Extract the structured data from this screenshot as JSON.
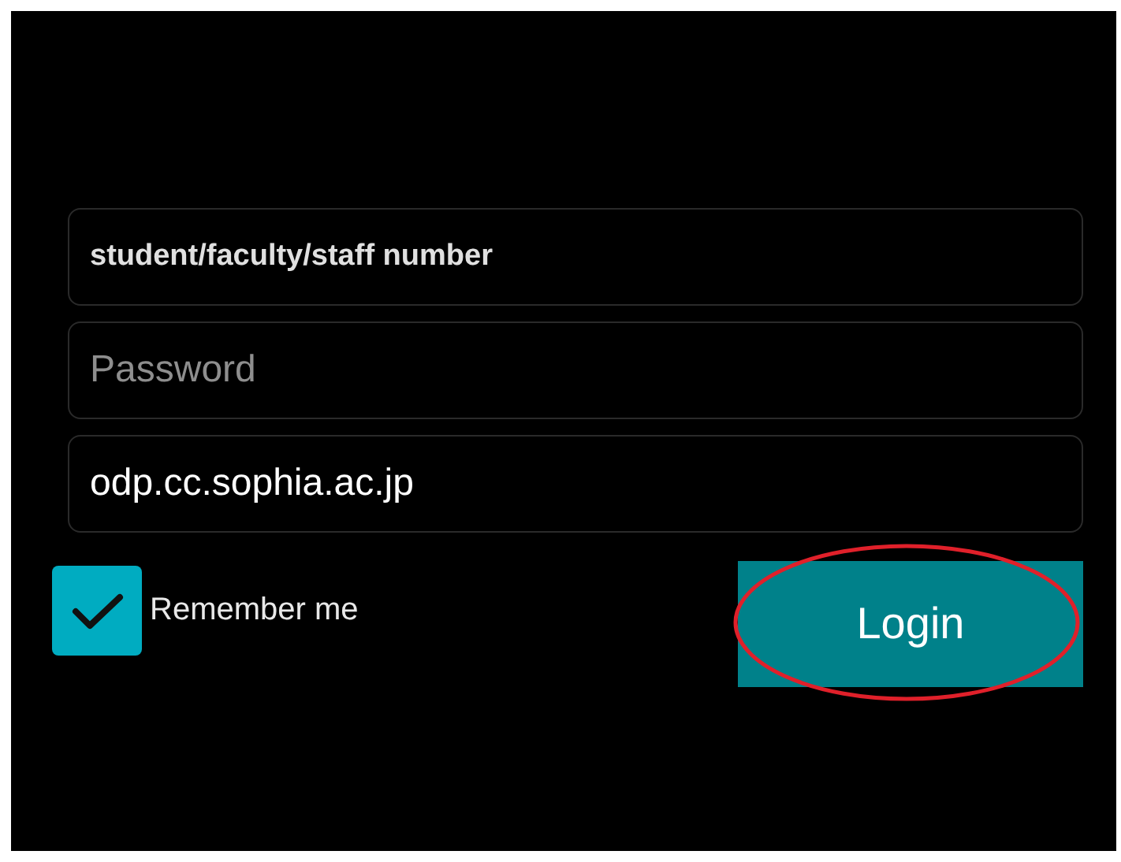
{
  "fields": [
    {
      "kind": "label",
      "placeholder": "student/faculty/staff number"
    },
    {
      "kind": "hint",
      "placeholder": "Password"
    },
    {
      "kind": "value",
      "value": "odp.cc.sophia.ac.jp"
    }
  ],
  "remember": {
    "label": "Remember me",
    "checked": true
  },
  "login_button": {
    "label": "Login"
  }
}
